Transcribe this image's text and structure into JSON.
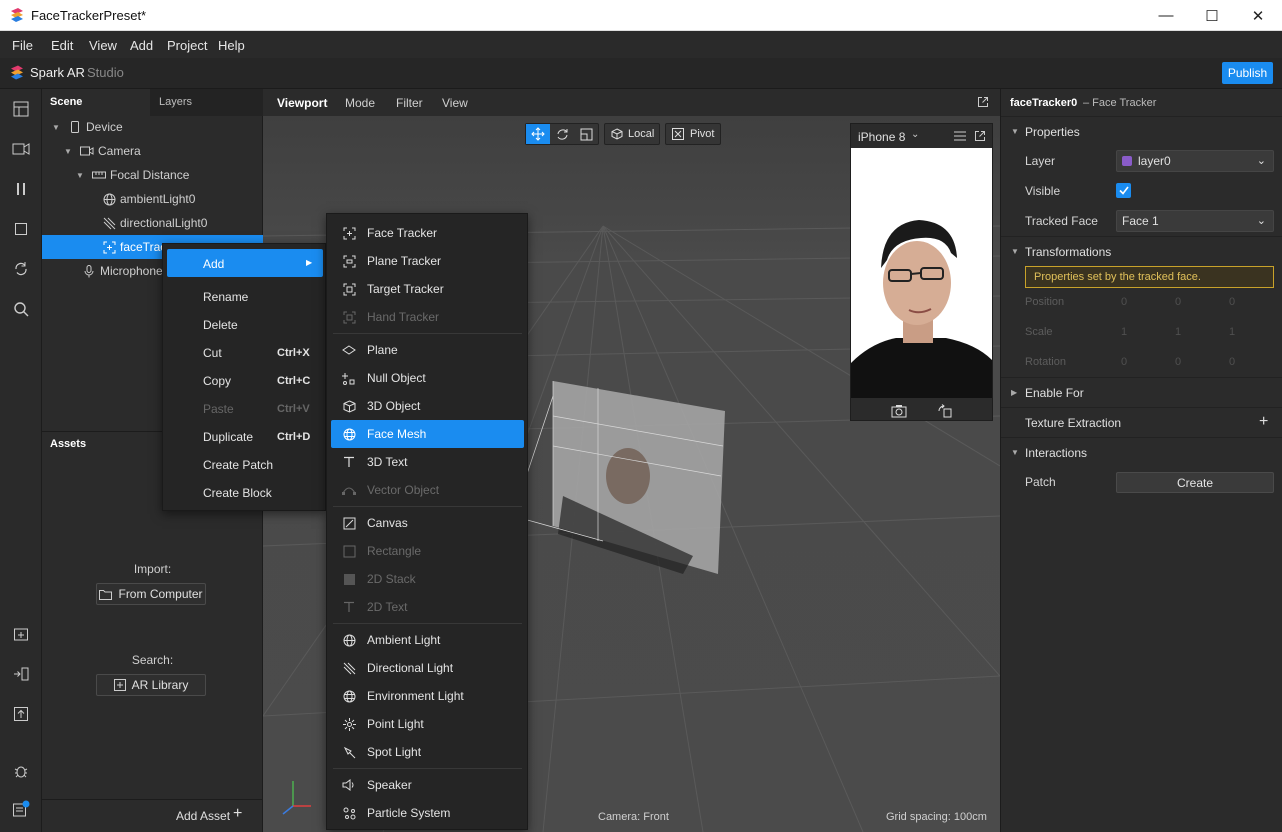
{
  "window": {
    "title": "FaceTrackerPreset*",
    "minimize": "—",
    "maximize": "☐",
    "close": "✕"
  },
  "menu": [
    "File",
    "Edit",
    "View",
    "Add",
    "Project",
    "Help"
  ],
  "brand": {
    "name": "Spark AR",
    "suffix": "Studio",
    "publish": "Publish"
  },
  "scene": {
    "tabs": [
      "Scene",
      "Layers"
    ],
    "tree": [
      {
        "label": "Device",
        "icon": "phone-icon"
      },
      {
        "label": "Camera",
        "icon": "camera-icon"
      },
      {
        "label": "Focal Distance",
        "icon": "focal-distance-icon"
      },
      {
        "label": "ambientLight0",
        "icon": "globe-light-icon"
      },
      {
        "label": "directionalLight0",
        "icon": "directional-light-icon"
      },
      {
        "label": "faceTrac",
        "icon": "face-tracker-icon"
      },
      {
        "label": "Microphone",
        "icon": "microphone-icon"
      }
    ]
  },
  "assets": {
    "title": "Assets",
    "import_label": "Import:",
    "from_computer": "From Computer",
    "search_label": "Search:",
    "ar_library": "AR Library",
    "add_asset": "Add Asset"
  },
  "viewport": {
    "tabs": [
      "Viewport",
      "Mode",
      "Filter",
      "View"
    ],
    "local": "Local",
    "pivot": "Pivot",
    "camera": "Camera: Front",
    "grid": "Grid spacing: 100cm",
    "device": "iPhone 8"
  },
  "context_menu": {
    "add": "Add",
    "items": [
      {
        "label": "Rename",
        "shortcut": "",
        "enabled": true
      },
      {
        "label": "Delete",
        "shortcut": "",
        "enabled": true
      },
      {
        "label": "Cut",
        "shortcut": "Ctrl+X",
        "enabled": true
      },
      {
        "label": "Copy",
        "shortcut": "Ctrl+C",
        "enabled": true
      },
      {
        "label": "Paste",
        "shortcut": "Ctrl+V",
        "enabled": false
      },
      {
        "label": "Duplicate",
        "shortcut": "Ctrl+D",
        "enabled": true
      },
      {
        "label": "Create Patch",
        "shortcut": "",
        "enabled": true
      },
      {
        "label": "Create Block",
        "shortcut": "",
        "enabled": true
      }
    ]
  },
  "submenu": {
    "groups": [
      [
        {
          "label": "Face Tracker",
          "icon": "face-tracker-icon",
          "enabled": true
        },
        {
          "label": "Plane Tracker",
          "icon": "plane-tracker-icon",
          "enabled": true
        },
        {
          "label": "Target Tracker",
          "icon": "target-tracker-icon",
          "enabled": true
        },
        {
          "label": "Hand Tracker",
          "icon": "hand-tracker-icon",
          "enabled": false
        }
      ],
      [
        {
          "label": "Plane",
          "icon": "plane-icon",
          "enabled": true
        },
        {
          "label": "Null Object",
          "icon": "null-object-icon",
          "enabled": true
        },
        {
          "label": "3D Object",
          "icon": "cube-icon",
          "enabled": true
        },
        {
          "label": "Face Mesh",
          "icon": "face-mesh-icon",
          "enabled": true,
          "highlight": true
        },
        {
          "label": "3D Text",
          "icon": "text-icon",
          "enabled": true
        },
        {
          "label": "Vector Object",
          "icon": "vector-object-icon",
          "enabled": false
        }
      ],
      [
        {
          "label": "Canvas",
          "icon": "canvas-icon",
          "enabled": true
        },
        {
          "label": "Rectangle",
          "icon": "rectangle-icon",
          "enabled": false
        },
        {
          "label": "2D Stack",
          "icon": "stack-icon",
          "enabled": false
        },
        {
          "label": "2D Text",
          "icon": "text-icon",
          "enabled": false
        }
      ],
      [
        {
          "label": "Ambient Light",
          "icon": "globe-light-icon",
          "enabled": true
        },
        {
          "label": "Directional Light",
          "icon": "directional-light-icon",
          "enabled": true
        },
        {
          "label": "Environment Light",
          "icon": "environment-light-icon",
          "enabled": true
        },
        {
          "label": "Point Light",
          "icon": "point-light-icon",
          "enabled": true
        },
        {
          "label": "Spot Light",
          "icon": "spot-light-icon",
          "enabled": true
        }
      ],
      [
        {
          "label": "Speaker",
          "icon": "speaker-icon",
          "enabled": true
        },
        {
          "label": "Particle System",
          "icon": "particle-system-icon",
          "enabled": true
        }
      ]
    ]
  },
  "inspector": {
    "object_name": "faceTracker0",
    "object_type": "– Face Tracker",
    "properties": "Properties",
    "layer_label": "Layer",
    "layer_value": "layer0",
    "layer_color": "#8a5cc9",
    "visible_label": "Visible",
    "visible_checked": true,
    "tracked_label": "Tracked Face",
    "tracked_value": "Face 1",
    "transformations": "Transformations",
    "warning": "Properties set by the tracked face.",
    "position": "Position",
    "position_values": [
      "0",
      "0",
      "0"
    ],
    "scale": "Scale",
    "scale_values": [
      "1",
      "1",
      "1"
    ],
    "rotation": "Rotation",
    "rotation_values": [
      "0",
      "0",
      "0"
    ],
    "enable_for": "Enable For",
    "texture_extraction": "Texture Extraction",
    "interactions": "Interactions",
    "patch_label": "Patch",
    "create": "Create"
  },
  "colors": {
    "accent": "#1a8cf0",
    "warning_border": "#c8a22a",
    "warning_text": "#e0c05a"
  }
}
